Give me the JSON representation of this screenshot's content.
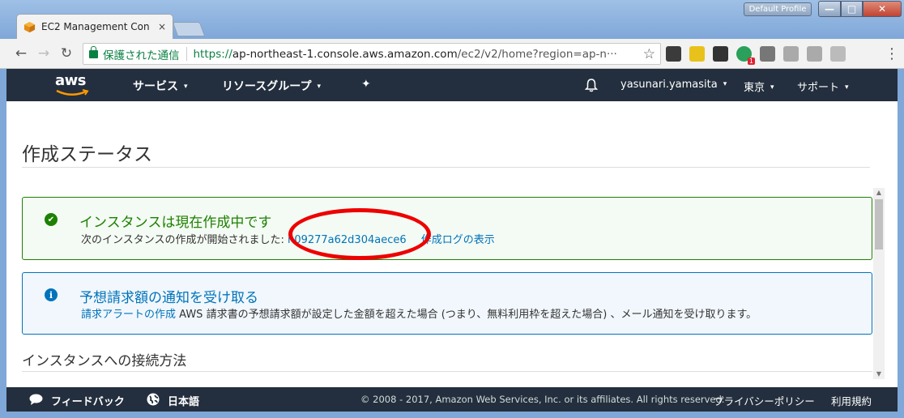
{
  "browser": {
    "tab_title": "EC2 Management Con",
    "tab_close": "×",
    "profile": "Default Profile",
    "window_buttons": {
      "minimize": "—",
      "maximize": "□",
      "close": "✕"
    },
    "secure_label": "保護された通信",
    "url_scheme": "https://",
    "url_host": "ap-northeast-1.console.aws.amazon.com",
    "url_path": "/ec2/v2/home?region=ap-n···",
    "icons": {
      "back": "←",
      "forward": "→",
      "reload": "↻",
      "star": "☆",
      "menu": "⋮"
    }
  },
  "awsnav": {
    "logo": "aws",
    "services": "サービス",
    "resource_groups": "リソースグループ",
    "pin_icon": "✦",
    "bell_icon": "🔔",
    "user": "yasunari.yamasita",
    "region": "東京",
    "support": "サポート",
    "caret": "▾"
  },
  "page": {
    "title": "作成ステータス",
    "success": {
      "heading": "インスタンスは現在作成中です",
      "message": "次のインスタンスの作成が開始されました:",
      "instance_id": "i-09277a62d304aece6",
      "log_link": "作成ログの表示"
    },
    "info": {
      "heading": "予想請求額の通知を受け取る",
      "link": "請求アラートの作成",
      "message": " AWS 請求書の予想請求額が設定した金額を超えた場合 (つまり、無料利用枠を超えた場合) 、メール通知を受け取ります。"
    },
    "section_title": "インスタンスへの接続方法"
  },
  "footer": {
    "feedback": "フィードバック",
    "language": "日本語",
    "copyright": "© 2008 - 2017, Amazon Web Services, Inc. or its affiliates. All rights reserved.",
    "privacy": "プライバシーポリシー",
    "terms": "利用規約"
  },
  "colors": {
    "aws_nav": "#232f3e",
    "success": "#1d8102",
    "info": "#0073bb",
    "highlight_oval": "#e00000"
  }
}
